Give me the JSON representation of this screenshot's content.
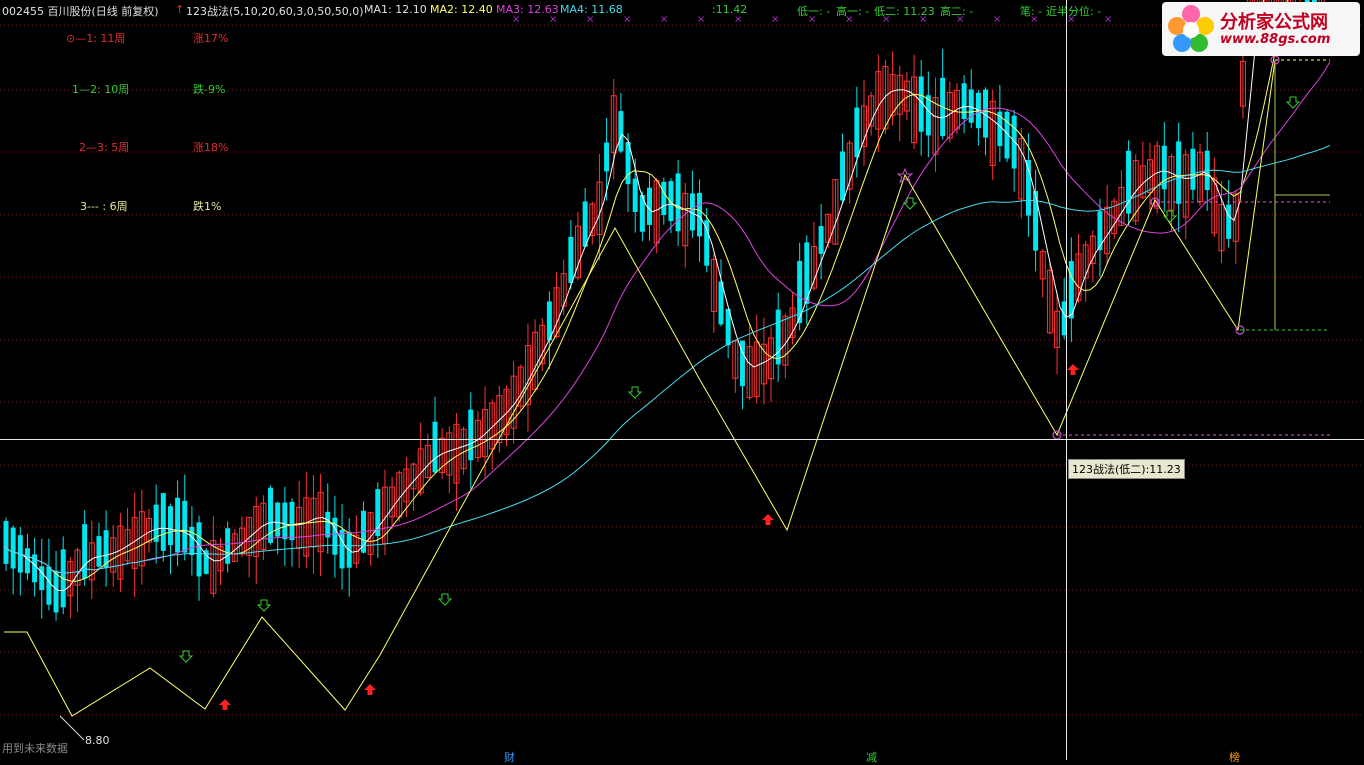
{
  "header": {
    "stock_title": "002455 百川股份(日线 前复权)",
    "indicator_name": "123战法(5,10,20,60,3,0,50,50,0)",
    "ma1": "MA1: 12.10",
    "ma2": "MA2: 12.40",
    "ma3": "MA3: 12.63",
    "ma4": "MA4: 11.68",
    "value_11_42": ":11.42",
    "low1": "低一: -",
    "high1": "高一: -",
    "low2": "低二: 11.23",
    "high2": "高二: -",
    "pen": "笔: -",
    "near_half": "近半分位: -"
  },
  "stats": [
    {
      "label": "⊙—1: 11周",
      "value": "涨17%",
      "label_color": "#e03030",
      "value_color": "#e03030"
    },
    {
      "label": "1—2: 10周",
      "value": "跌-9%",
      "label_color": "#33cc33",
      "value_color": "#33cc33"
    },
    {
      "label": "2—3: 5周",
      "value": "涨18%",
      "label_color": "#e03030",
      "value_color": "#e03030"
    },
    {
      "label": "3--- : 6周",
      "value": "跌1%",
      "label_color": "#e8e8a0",
      "value_color": "#e8e8a0"
    }
  ],
  "footer_text": "用到未来数据",
  "low_value_label": "8.80",
  "tooltip": "123战法(低二):11.23",
  "axis_marks": [
    {
      "text": "财",
      "color": "#3399ff"
    },
    {
      "text": "减",
      "color": "#33cc33"
    },
    {
      "text": "榜",
      "color": "#ff9900"
    }
  ],
  "logo": {
    "title": "分析家公式网",
    "url": "www.88gs.com"
  },
  "colors": {
    "up": "#ff3333",
    "down": "#00e5ee",
    "ma_white": "#ffffff",
    "ma_yellow": "#ffff66",
    "ma_magenta": "#dd44dd",
    "ma_cyan": "#44ddee",
    "zigzag": "#ffff66"
  },
  "chart_data": {
    "type": "candlestick",
    "y_unit": "price (CNY)",
    "marked_low": 8.8,
    "marked_low2": 11.23,
    "zigzag_prices": [
      9.2,
      8.8,
      9.8,
      8.9,
      10.1,
      9.3,
      11.6,
      16.3,
      14.4,
      12.6,
      17.0,
      13.4,
      16.6,
      14.4,
      19.2
    ]
  }
}
